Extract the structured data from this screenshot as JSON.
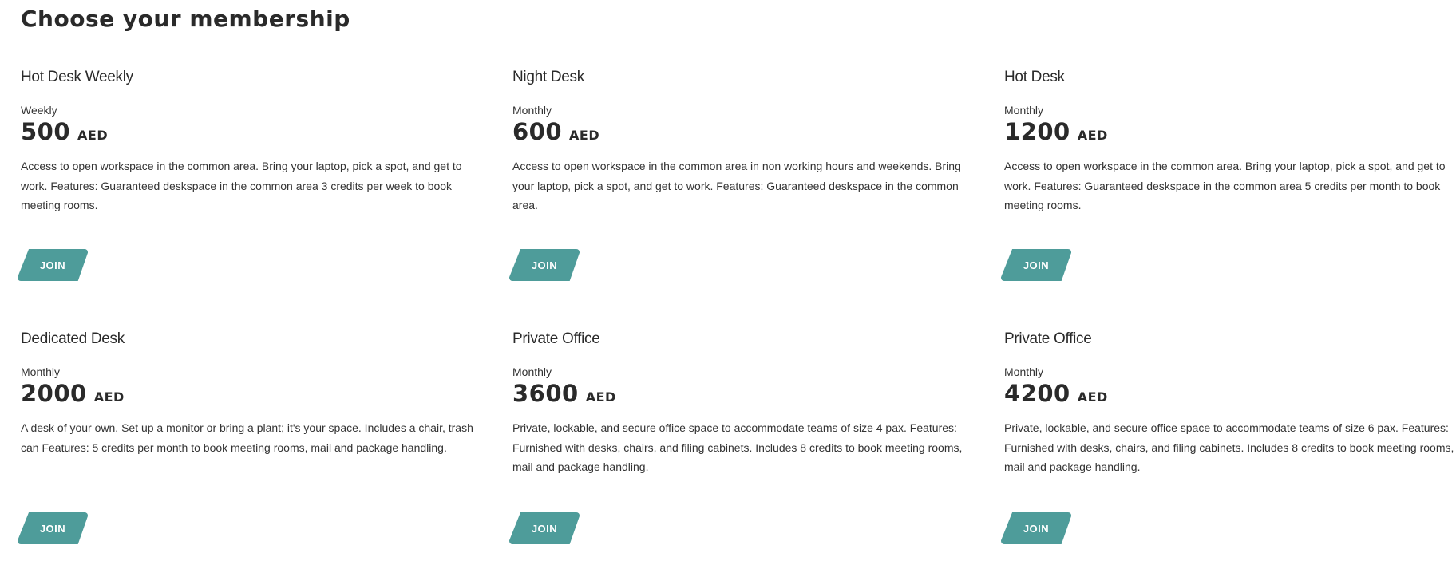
{
  "page": {
    "title": "Choose your membership"
  },
  "plans": [
    {
      "name": "Hot Desk Weekly",
      "period": "Weekly",
      "price": "500",
      "currency": "AED",
      "description": "Access to open workspace in the common area. Bring your laptop, pick a spot, and get to work. Features: Guaranteed deskspace in the common area 3 credits per week to book meeting rooms.",
      "button_label": "JOIN"
    },
    {
      "name": "Night Desk",
      "period": "Monthly",
      "price": "600",
      "currency": "AED",
      "description": "Access to open workspace in the common area in non working hours and weekends. Bring your laptop, pick a spot, and get to work. Features: Guaranteed deskspace in the common area.",
      "button_label": "JOIN"
    },
    {
      "name": "Hot Desk",
      "period": "Monthly",
      "price": "1200",
      "currency": "AED",
      "description": "Access to open workspace in the common area. Bring your laptop, pick a spot, and get to work. Features: Guaranteed deskspace in the common area 5 credits per month to book meeting rooms.",
      "button_label": "JOIN"
    },
    {
      "name": "Dedicated Desk",
      "period": "Monthly",
      "price": "2000",
      "currency": "AED",
      "description": "A desk of your own. Set up a monitor or bring a plant; it's your space. Includes a chair, trash can Features: 5 credits per month to book meeting rooms, mail and package handling.",
      "button_label": "JOIN"
    },
    {
      "name": "Private Office",
      "period": "Monthly",
      "price": "3600",
      "currency": "AED",
      "description": "Private, lockable, and secure office space to accommodate teams of size 4 pax. Features: Furnished with desks, chairs, and filing cabinets. Includes 8 credits to book meeting rooms, mail and package handling.",
      "button_label": "JOIN"
    },
    {
      "name": "Private Office",
      "period": "Monthly",
      "price": "4200",
      "currency": "AED",
      "description": "Private, lockable, and secure office space to accommodate teams of size 6 pax. Features: Furnished with desks, chairs, and filing cabinets. Includes 8 credits to book meeting rooms, mail and package handling.",
      "button_label": "JOIN"
    }
  ],
  "colors": {
    "accent": "#4e9c9a",
    "text": "#2a2a2a",
    "background": "#ffffff"
  }
}
